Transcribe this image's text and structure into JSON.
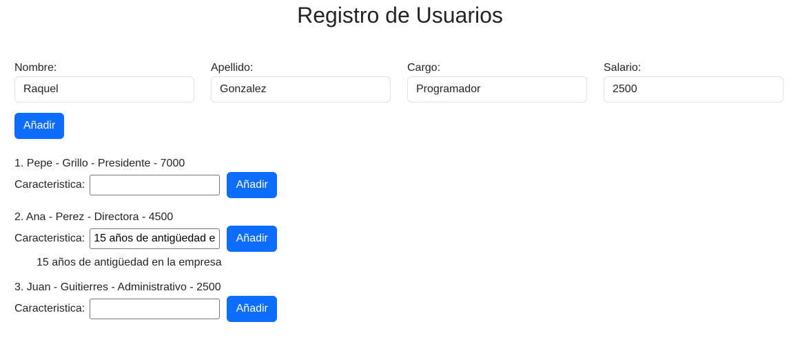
{
  "page": {
    "title": "Registro de Usuarios"
  },
  "form": {
    "fields": [
      {
        "label": "Nombre:",
        "value": "Raquel"
      },
      {
        "label": "Apellido:",
        "value": "Gonzalez"
      },
      {
        "label": "Cargo:",
        "value": "Programador"
      },
      {
        "label": "Salario:",
        "value": "2500"
      }
    ],
    "add_label": "Añadir"
  },
  "users": [
    {
      "line": "1. Pepe - Grillo - Presidente - 7000",
      "feature_label": "Caracteristica:",
      "feature_input_value": "",
      "add_label": "Añadir",
      "features": []
    },
    {
      "line": "2. Ana - Perez - Directora - 4500",
      "feature_label": "Caracteristica:",
      "feature_input_value": "15 años de antigüedad en la empresa",
      "add_label": "Añadir",
      "features": [
        "15 años de antigüedad en la empresa"
      ]
    },
    {
      "line": "3. Juan - Guitierres - Administrativo - 2500",
      "feature_label": "Caracteristica:",
      "feature_input_value": "",
      "add_label": "Añadir",
      "features": []
    }
  ],
  "colors": {
    "primary": "#0d6efd",
    "text": "#212529",
    "input_border": "#dee2e6"
  }
}
